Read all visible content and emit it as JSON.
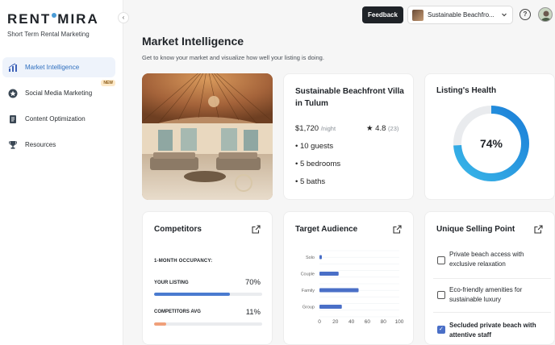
{
  "brand": {
    "name": "RENTAMIRA",
    "tagline": "Short Term Rental Marketing"
  },
  "sidebar": {
    "collapse_glyph": "‹",
    "items": [
      {
        "label": "Market Intelligence",
        "icon": "chart-icon",
        "active": true
      },
      {
        "label": "Social Media Marketing",
        "icon": "star-icon",
        "badge": "NEW"
      },
      {
        "label": "Content Optimization",
        "icon": "document-icon"
      },
      {
        "label": "Resources",
        "icon": "trophy-icon"
      }
    ]
  },
  "topbar": {
    "feedback_label": "Feedback",
    "listing_select": "Sustainable Beachfro...",
    "help_glyph": "?"
  },
  "page": {
    "title": "Market Intelligence",
    "subtitle": "Get to know your market and visualize how well your listing is doing."
  },
  "listing": {
    "name": "Sustainable Beachfront Villa in Tulum",
    "price": "$1,720",
    "price_unit": "/night",
    "rating": "4.8",
    "rating_count": "(23)",
    "details": [
      "• 10 guests",
      "• 5 bedrooms",
      "• 5 baths"
    ]
  },
  "health": {
    "title": "Listing's Health",
    "value": 74,
    "label": "74%"
  },
  "competitors": {
    "title": "Competitors",
    "occupancy_label": "1-MONTH OCCUPANCY:",
    "rows": [
      {
        "label": "YOUR LISTING",
        "value": "70%",
        "fill": 70,
        "color": "#4a7bd0"
      },
      {
        "label": "COMPETITORS AVG",
        "value": "11%",
        "fill": 11,
        "color": "#f0a07a"
      }
    ]
  },
  "audience": {
    "title": "Target Audience",
    "chart_data": {
      "type": "bar",
      "orientation": "horizontal",
      "categories": [
        "Solo",
        "Couple",
        "Family",
        "Group"
      ],
      "values": [
        3,
        24,
        49,
        28
      ],
      "xlim": [
        0,
        100
      ],
      "xticks": [
        "0",
        "20",
        "40",
        "60",
        "80",
        "100"
      ],
      "color": "#4a6fc7"
    }
  },
  "usp": {
    "title": "Unique Selling Point",
    "items": [
      {
        "text": "Private beach access with exclusive relaxation",
        "checked": false
      },
      {
        "text": "Eco-friendly amenities for sustainable luxury",
        "checked": false
      },
      {
        "text": "Secluded private beach with attentive staff",
        "checked": true
      }
    ]
  }
}
